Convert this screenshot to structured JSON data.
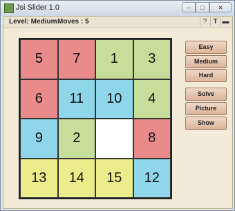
{
  "window": {
    "title": "Jsi Slider 1.0",
    "help_label": "?",
    "text_label": "T"
  },
  "status": {
    "level": "Level: Medium",
    "moves": "Moves : 5"
  },
  "colors": {
    "red": "#e98b8b",
    "blue": "#8fd6ea",
    "green": "#c6de9a",
    "yellow": "#ecec8c",
    "empty": "#ffffff"
  },
  "board": {
    "rows": [
      [
        {
          "label": "5",
          "color": "red"
        },
        {
          "label": "7",
          "color": "red"
        },
        {
          "label": "1",
          "color": "green"
        },
        {
          "label": "3",
          "color": "green"
        }
      ],
      [
        {
          "label": "6",
          "color": "red"
        },
        {
          "label": "11",
          "color": "blue"
        },
        {
          "label": "10",
          "color": "blue"
        },
        {
          "label": "4",
          "color": "green"
        }
      ],
      [
        {
          "label": "9",
          "color": "blue"
        },
        {
          "label": "2",
          "color": "green"
        },
        {
          "label": "",
          "color": "empty"
        },
        {
          "label": "8",
          "color": "red"
        }
      ],
      [
        {
          "label": "13",
          "color": "yellow"
        },
        {
          "label": "14",
          "color": "yellow"
        },
        {
          "label": "15",
          "color": "yellow"
        },
        {
          "label": "12",
          "color": "blue"
        }
      ]
    ]
  },
  "buttons": {
    "easy": "Easy",
    "medium": "Medium",
    "hard": "Hard",
    "solve": "Solve",
    "picture": "Picture",
    "show": "Show"
  }
}
